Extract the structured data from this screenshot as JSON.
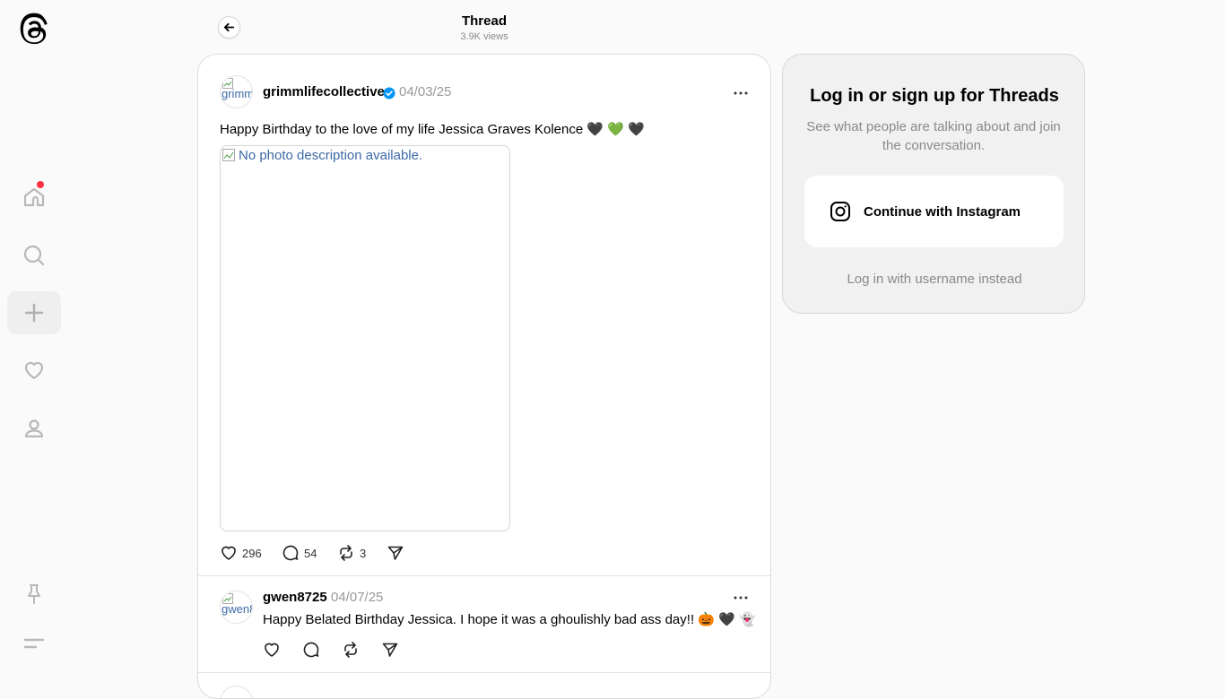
{
  "header": {
    "title": "Thread",
    "views": "3.9K views"
  },
  "sidebar": {
    "items": [
      {
        "name": "home",
        "notification": true
      },
      {
        "name": "search"
      },
      {
        "name": "create"
      },
      {
        "name": "activity"
      },
      {
        "name": "profile"
      }
    ]
  },
  "main_post": {
    "avatar_alt": "grimmlifecollective",
    "username": "grimmlifecollective",
    "verified": true,
    "date": "04/03/25",
    "text": "Happy Birthday to the love of my life Jessica Graves Kolence 🖤 💚 🖤",
    "image_alt": "No photo description available.",
    "likes": "296",
    "replies": "54",
    "reposts": "3"
  },
  "reply": {
    "avatar_alt": "gwen8725",
    "username": "gwen8725",
    "date": "04/07/25",
    "text": "Happy Belated Birthday Jessica. I hope it was a ghoulishly bad ass day!! 🎃 🖤 👻"
  },
  "login_card": {
    "title": "Log in or sign up for Threads",
    "subtitle": "See what people are talking about and join the conversation.",
    "instagram_button": "Continue with Instagram",
    "username_link": "Log in with username instead"
  },
  "colors": {
    "notification_dot": "#ff3040",
    "verified": "#0095f6",
    "link": "#3c6aa6"
  }
}
